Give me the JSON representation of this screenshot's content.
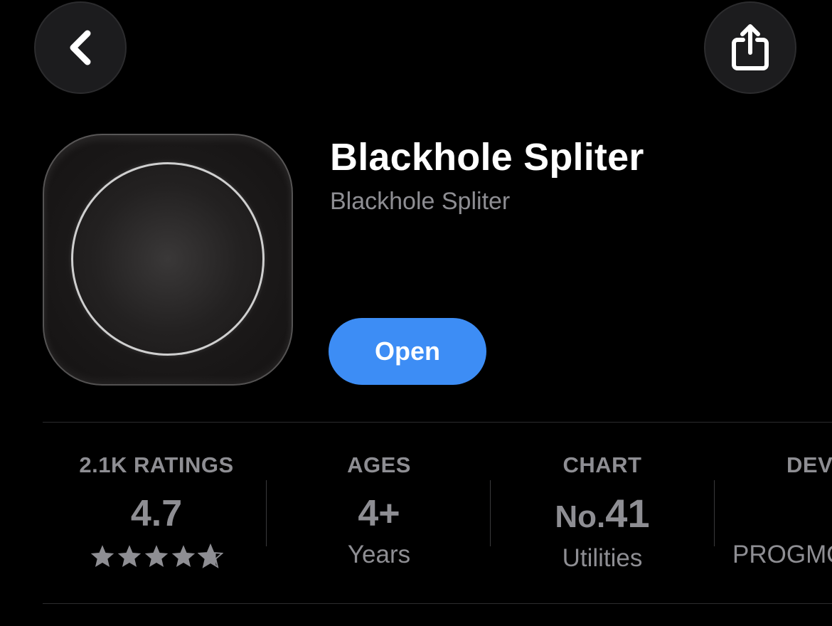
{
  "nav": {
    "back_icon": "chevron-left-icon",
    "share_icon": "share-icon"
  },
  "app": {
    "title": "Blackhole Spliter",
    "subtitle": "Blackhole Spliter",
    "open_label": "Open",
    "accent_color": "#3d8df5",
    "icon": "blackhole-app-icon"
  },
  "stats": {
    "ratings": {
      "label": "2.1K RATINGS",
      "value": "4.7",
      "stars": 4.7,
      "star_icon": "star-icon"
    },
    "ages": {
      "label": "AGES",
      "value": "4+",
      "sub": "Years"
    },
    "chart": {
      "label": "CHART",
      "prefix": "No.",
      "value": "41",
      "sub": "Utilities"
    },
    "developer": {
      "label": "DEV",
      "sub": "PROGMO"
    }
  }
}
